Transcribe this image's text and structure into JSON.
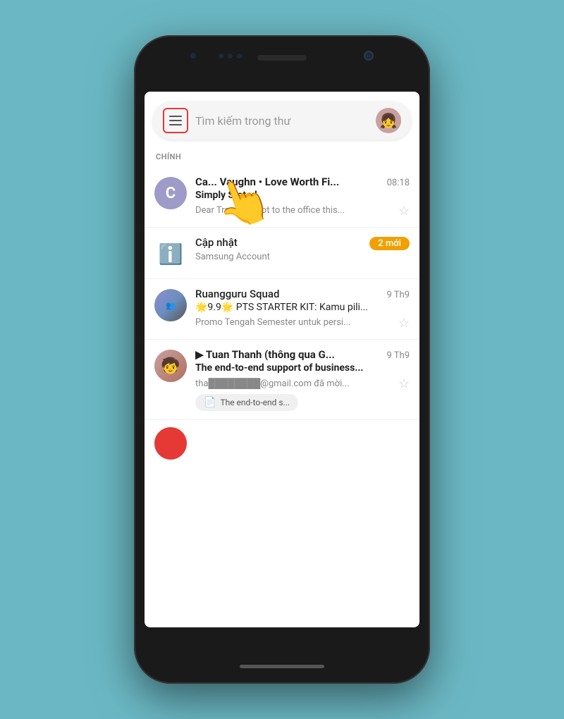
{
  "phone": {
    "background_color": "#6bb8c4"
  },
  "search_bar": {
    "placeholder": "Tìm kiếm trong thư",
    "menu_icon_label": "≡"
  },
  "section": {
    "label": "CHÍNH"
  },
  "emails": [
    {
      "id": "email-1",
      "avatar_letter": "C",
      "avatar_color": "purple",
      "sender": "Ca... Vaughn • Love Worth Fi...",
      "time": "08:18",
      "subject": "Simply Stated",
      "preview": "Dear Tran, As I got to the office this...",
      "starred": false,
      "is_bold": true
    },
    {
      "id": "email-2",
      "avatar_icon": "ℹ",
      "avatar_color": "info",
      "sender": "Cập nhật",
      "sub_sender": "Samsung Account",
      "time": "",
      "badge": "2 mới",
      "is_bold": false
    },
    {
      "id": "email-3",
      "avatar_type": "group",
      "sender": "Ruangguru Squad",
      "time": "9 Th9",
      "subject": "🌟9.9🌟 PTS STARTER KIT: Kamu pili...",
      "preview": "Promo Tengah Semester untuk persi...",
      "starred": false
    },
    {
      "id": "email-4",
      "avatar_type": "tuan",
      "sender": "▶ Tuan Thanh (thông qua G...",
      "sender_bold": true,
      "time": "9 Th9",
      "subject": "The end-to-end support of business...",
      "preview": "tha████████@gmail.com đã mời...",
      "starred": false,
      "has_chip": true,
      "chip_text": "The end-to-end s..."
    }
  ],
  "bottom_partial": {
    "avatar_color": "#e53935"
  },
  "hand_emoji": "👆"
}
